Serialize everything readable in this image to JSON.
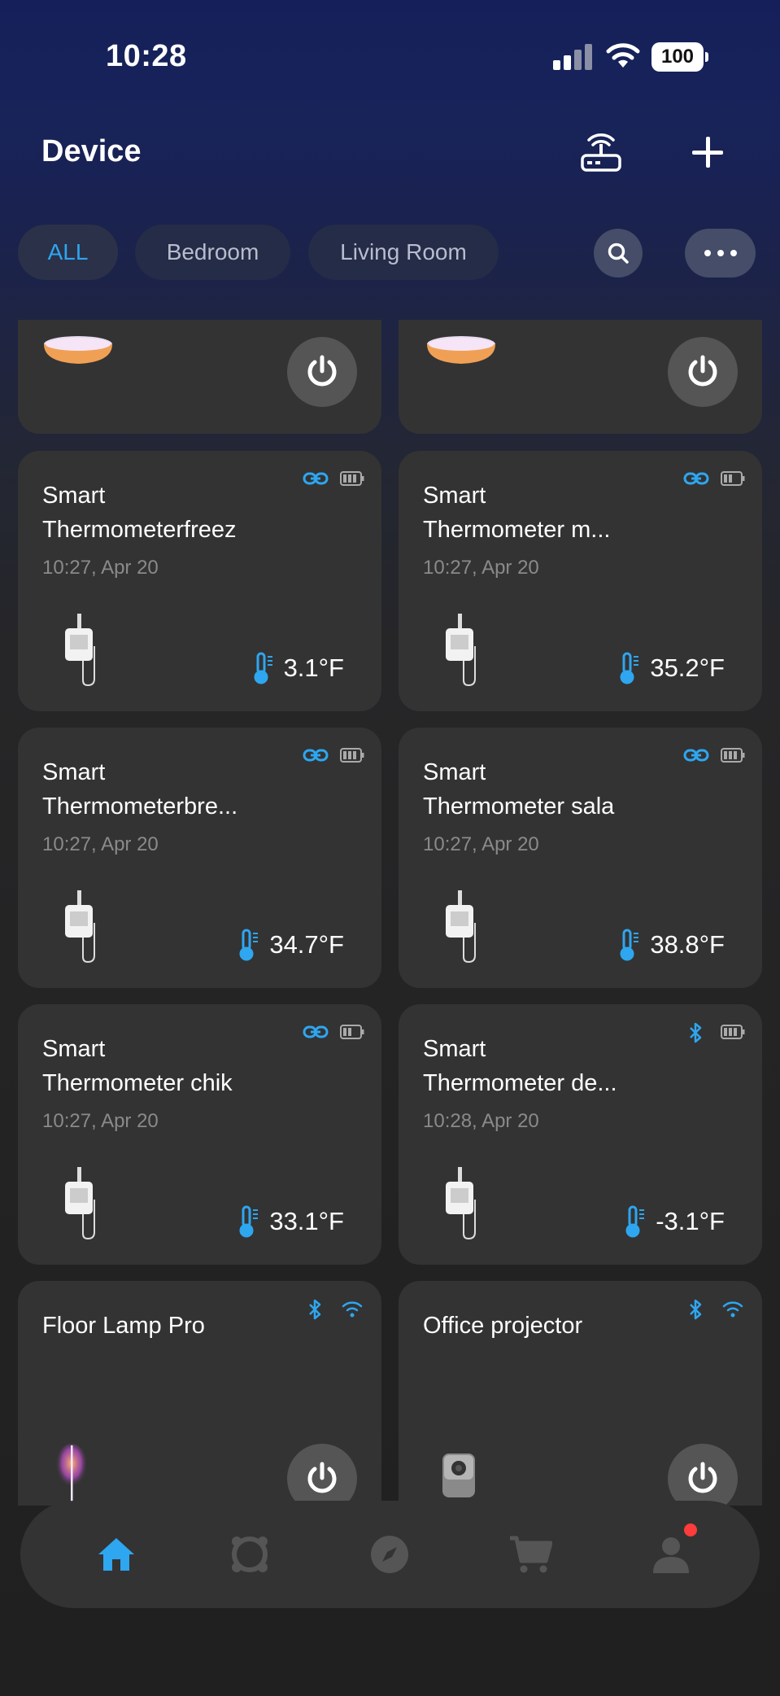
{
  "status_bar": {
    "time": "10:28",
    "battery": "100"
  },
  "header": {
    "title": "Device"
  },
  "tabs": [
    {
      "label": "ALL",
      "active": true
    },
    {
      "label": "Bedroom",
      "active": false
    },
    {
      "label": "Living Room",
      "active": false
    }
  ],
  "devices": [
    {
      "type": "lamp",
      "name": ""
    },
    {
      "type": "lamp",
      "name": ""
    },
    {
      "type": "thermometer",
      "name": "Smart\nThermometerfreez",
      "time": "10:27,  Apr 20",
      "temp": "3.1°F",
      "link": "link-icon"
    },
    {
      "type": "thermometer",
      "name": "Smart\nThermometer m...",
      "time": "10:27,  Apr 20",
      "temp": "35.2°F",
      "link": "link-icon"
    },
    {
      "type": "thermometer",
      "name": "Smart\nThermometerbre...",
      "time": "10:27,  Apr 20",
      "temp": "34.7°F",
      "link": "link-icon"
    },
    {
      "type": "thermometer",
      "name": "Smart\nThermometer sala",
      "time": "10:27,  Apr 20",
      "temp": "38.8°F",
      "link": "link-icon"
    },
    {
      "type": "thermometer",
      "name": "Smart\nThermometer chik",
      "time": "10:27,  Apr 20",
      "temp": "33.1°F",
      "link": "link-icon"
    },
    {
      "type": "thermometer",
      "name": "Smart\nThermometer de...",
      "time": "10:28,  Apr 20",
      "temp": "-3.1°F",
      "link": "bluetooth-icon"
    },
    {
      "type": "floor-lamp",
      "name": "Floor Lamp Pro"
    },
    {
      "type": "projector",
      "name": "Office projector"
    }
  ],
  "nav": [
    {
      "name": "home-icon",
      "active": true
    },
    {
      "name": "scenes-icon",
      "active": false
    },
    {
      "name": "discover-icon",
      "active": false
    },
    {
      "name": "shop-icon",
      "active": false
    },
    {
      "name": "profile-icon",
      "active": false,
      "badge": true
    }
  ],
  "colors": {
    "accent": "#2ea6f0",
    "card": "#333333",
    "badge": "#ff3b3b"
  }
}
